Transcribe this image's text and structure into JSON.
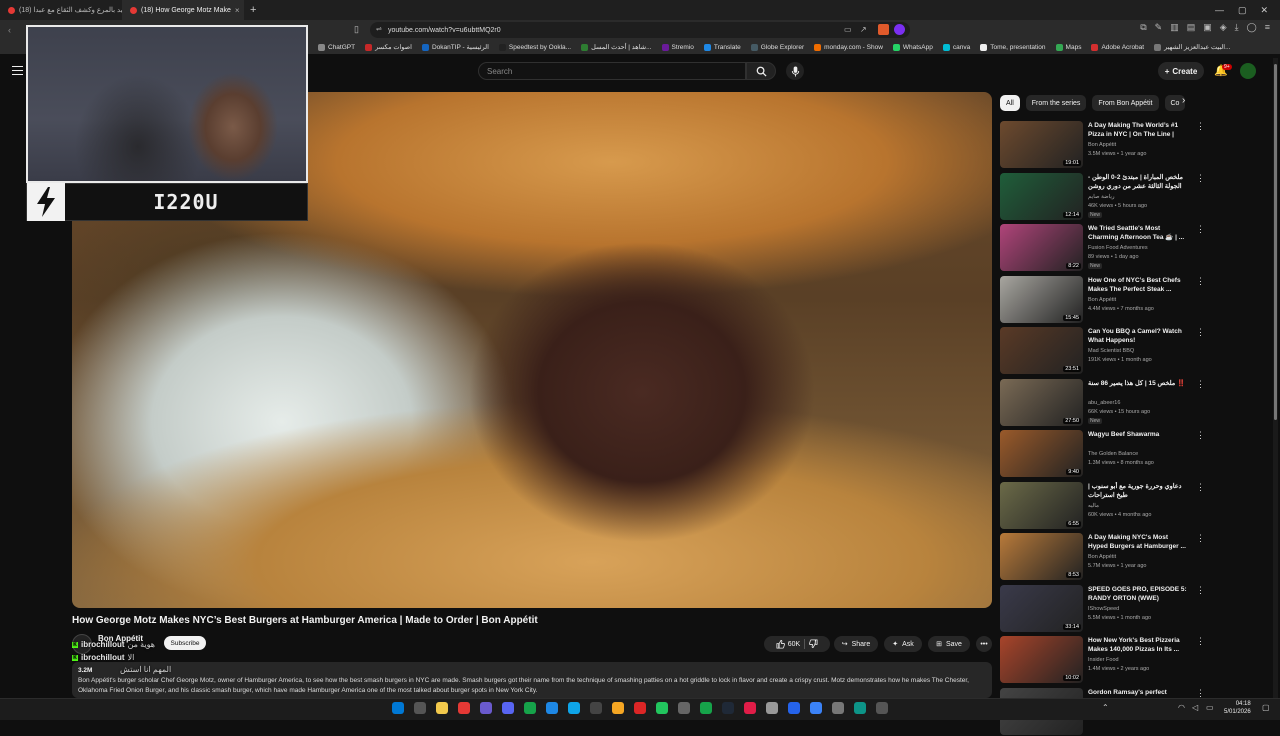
{
  "browser": {
    "tabs": [
      {
        "label": "(18) حنيد بالمرع وكشف الثقاع مع عبدا...",
        "active": false
      },
      {
        "label": "(18) How George Motz Make",
        "active": true
      }
    ],
    "url": "youtube.com/watch?v=u6ubttMQ2r0",
    "bookmarks": [
      "ChatGPT",
      "اصوات مكسر",
      "DokanTIP - الرئيسية",
      "Speedtest by Ookla...",
      "شاهد | أحدث المسل...",
      "Stremio",
      "Translate",
      "Globe Explorer",
      "monday.com - Show",
      "WhatsApp",
      "canva",
      "Tome, presentation",
      "Maps",
      "Adobe Acrobat",
      "البيت عبدالعزيز الشهير..."
    ]
  },
  "youtube": {
    "search_placeholder": "Search",
    "create_label": "Create",
    "notif_count": "9+"
  },
  "overlay": {
    "streamer_name": "I220U"
  },
  "video": {
    "title": "How George Motz Makes NYC’s Best Burgers at Hamburger America | Made to Order | Bon Appétit",
    "channel": "Bon Appétit",
    "subscribe_label": "Subscribe",
    "likes": "60K",
    "share_label": "Share",
    "ask_label": "Ask",
    "save_label": "Save",
    "views_line": "3.2M",
    "description": "Bon Appétit's burger scholar Chef George Motz, owner of Hamburger America, to see how the best smash burgers in NYC are made. Smash burgers got their name from the technique of smashing patties on a hot griddle to lock in flavor and create a crispy crust. Motz demonstrates how he makes The Chester, Oklahoma Fried Onion Burger, and his classic smash burger, which have made Hamburger America one of the most talked about burger spots in New York City."
  },
  "chat": [
    {
      "user": "ibrochillout",
      "msg": "هوية من"
    },
    {
      "user": "ibrochillout",
      "msg": "الا"
    },
    {
      "user": "",
      "msg": "المهم انا استش"
    }
  ],
  "chips": [
    "All",
    "From the series",
    "From Bon Appétit",
    "Co"
  ],
  "recommendations": [
    {
      "title": "A Day Making The World’s #1 Pizza in NYC | On The Line | Bo...",
      "channel": "Bon Appétit",
      "meta": "3.5M views • 1 year ago",
      "duration": "19:01",
      "badge": "",
      "color": "#6d4a2e"
    },
    {
      "title": "ملخص المباراة | مبتدئ 2-0 الوطن - الجولة الثالثة عشر من دوري روشن",
      "channel": "رياضة صايم",
      "meta": "46K views • 5 hours ago",
      "duration": "12:14",
      "badge": "New",
      "color": "#1f5e3a"
    },
    {
      "title": "We Tried Seattle's Most Charming Afternoon Tea ☕ | ...",
      "channel": "Fusion Food Adventures",
      "meta": "89 views • 1 day ago",
      "duration": "8:22",
      "badge": "New",
      "color": "#b0447a"
    },
    {
      "title": "How One of NYC’s Best Chefs Makes The Perfect Steak ...",
      "channel": "Bon Appétit",
      "meta": "4.4M views • 7 months ago",
      "duration": "15:45",
      "badge": "",
      "color": "#a8a6a0"
    },
    {
      "title": "Can You BBQ a Camel? Watch What Happens!",
      "channel": "Mad Scientist BBQ",
      "meta": "191K views • 1 month ago",
      "duration": "23:51",
      "badge": "",
      "color": "#5a3a26"
    },
    {
      "title": "ملخص 15 | كل هذا يصير 86 سنة ‼️",
      "channel": "abu_abeer16",
      "meta": "66K views • 15 hours ago",
      "duration": "27:50",
      "badge": "New",
      "color": "#7a6a55"
    },
    {
      "title": "Wagyu Beef Shawarma",
      "channel": "The Golden Balance",
      "meta": "1.3M views • 8 months ago",
      "duration": "9:40",
      "badge": "",
      "color": "#9a5a2a"
    },
    {
      "title": "دعاوي وحررة جورية مع أبو سنوب | طبخ استراحات",
      "channel": "ماليه",
      "meta": "60K views • 4 months ago",
      "duration": "6:55",
      "badge": "",
      "color": "#6b6a48"
    },
    {
      "title": "A Day Making NYC's Most Hyped Burgers at Hamburger ...",
      "channel": "Bon Appétit",
      "meta": "5.7M views • 1 year ago",
      "duration": "8:53",
      "badge": "",
      "color": "#b87a3a"
    },
    {
      "title": "SPEED GOES PRO, EPISODE 5: RANDY ORTON (WWE)",
      "channel": "IShowSpeed",
      "meta": "5.5M views • 1 month ago",
      "duration": "33:14",
      "badge": "",
      "color": "#3a3a4a"
    },
    {
      "title": "How New York's Best Pizzeria Makes 140,000 Pizzas In Its ...",
      "channel": "Insider Food",
      "meta": "1.4M views • 2 years ago",
      "duration": "10:02",
      "badge": "",
      "color": "#a8442a"
    },
    {
      "title": "Gordon Ramsay's perfect burger",
      "channel": "",
      "meta": "",
      "duration": "",
      "badge": "",
      "color": "#444"
    }
  ],
  "taskbar": {
    "time": "04:18",
    "date": "5/01/2026"
  },
  "colors": {
    "accent": "#cc0000",
    "kick_green": "#53fc18"
  }
}
